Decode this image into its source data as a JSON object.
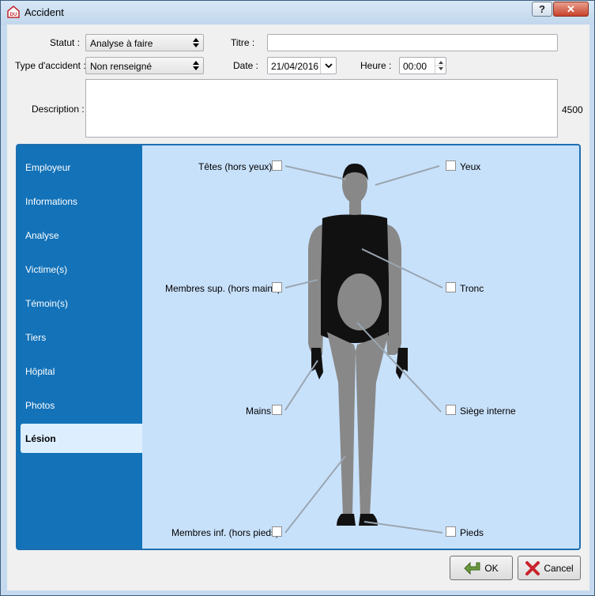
{
  "window": {
    "title": "Accident",
    "help_label": "?",
    "close_label": "✕"
  },
  "form": {
    "statut_label": "Statut :",
    "statut_value": "Analyse à faire",
    "titre_label": "Titre :",
    "titre_value": "",
    "type_label": "Type d'accident :",
    "type_value": "Non renseigné",
    "date_label": "Date :",
    "date_value": "21/04/2016",
    "heure_label": "Heure :",
    "heure_value": "00:00",
    "description_label": "Description :",
    "description_value": "",
    "char_count": "4500"
  },
  "sidebar": {
    "items": [
      {
        "label": "Employeur"
      },
      {
        "label": "Informations"
      },
      {
        "label": "Analyse"
      },
      {
        "label": "Victime(s)"
      },
      {
        "label": "Témoin(s)"
      },
      {
        "label": "Tiers"
      },
      {
        "label": "Hôpital"
      },
      {
        "label": "Photos"
      },
      {
        "label": "Lésion"
      }
    ],
    "active_index": 8
  },
  "lesion": {
    "tete": "Têtes (hors yeux)",
    "yeux": "Yeux",
    "membres_sup": "Membres sup. (hors mains)",
    "tronc": "Tronc",
    "mains": "Mains",
    "siege": "Siège interne",
    "membres_inf": "Membres inf. (hors pieds)",
    "pieds": "Pieds"
  },
  "buttons": {
    "ok": "OK",
    "cancel": "Cancel"
  },
  "colors": {
    "sidebar": "#1372b8",
    "panel": "#c8e1fb",
    "accent": "#1e6fb0"
  }
}
